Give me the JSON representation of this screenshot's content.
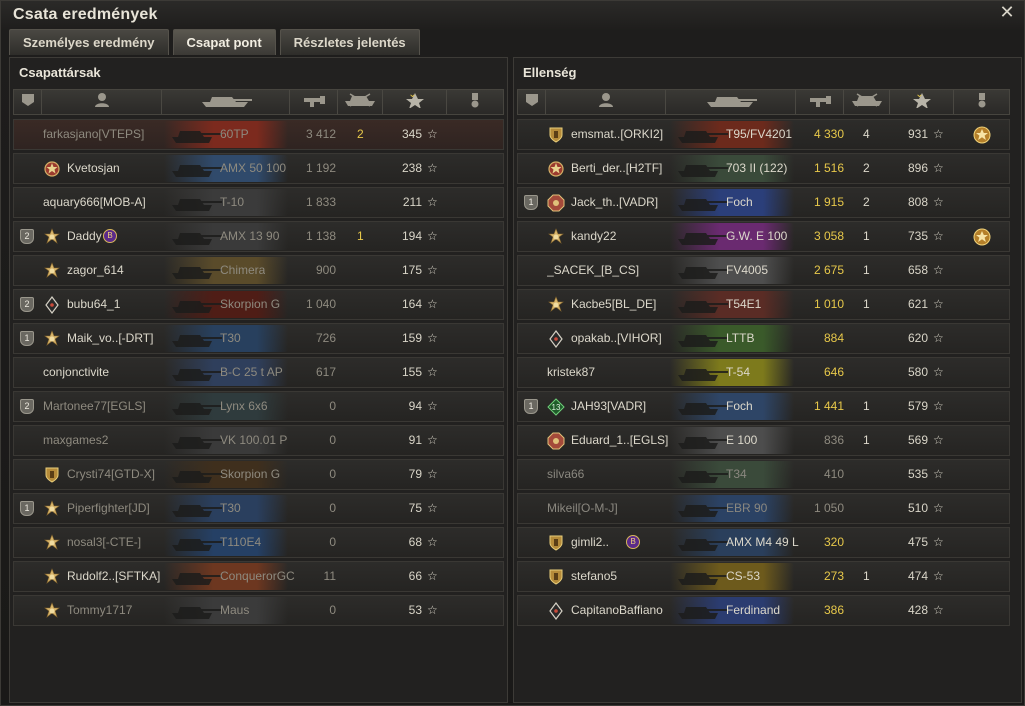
{
  "window": {
    "title": "Csata eredmények",
    "close_glyph": "✕"
  },
  "tabs": [
    {
      "label": "Személyes eredmény",
      "active": false
    },
    {
      "label": "Csapat pont",
      "active": true
    },
    {
      "label": "Részletes jelentés",
      "active": false
    }
  ],
  "left_panel": {
    "title": "Csapattársak",
    "header_icons": [
      "platoon-icon",
      "player-icon",
      "tank-icon",
      "damage-icon",
      "kills-icon",
      "xp-sort-icon",
      "awards-icon"
    ],
    "rows": [
      {
        "name": "farkasjano[VTEPS]",
        "badge": "",
        "medal": "",
        "tank": "60TP",
        "damage": "3 412",
        "kills": "2",
        "xp": "345",
        "dead": true,
        "award": ""
      },
      {
        "name": "Kvetosjan",
        "badge": "",
        "medal": "clan-medal",
        "tank": "AMX 50 100",
        "damage": "1 192",
        "kills": "",
        "xp": "238",
        "dead": false,
        "award": ""
      },
      {
        "name": "aquary666[MOB-A]",
        "badge": "",
        "medal": "",
        "tank": "T-10",
        "damage": "1 833",
        "kills": "",
        "xp": "211",
        "dead": false,
        "award": ""
      },
      {
        "name": "Daddy",
        "badge": "2",
        "medal": "star-medal",
        "tank": "AMX 13 90",
        "damage": "1 138",
        "kills": "1",
        "xp": "194",
        "dead": false,
        "award": "",
        "extra_badge": "B"
      },
      {
        "name": "zagor_614",
        "badge": "",
        "medal": "star-medal",
        "tank": "Chimera",
        "damage": "900",
        "kills": "",
        "xp": "175",
        "dead": false,
        "award": ""
      },
      {
        "name": "bubu64_1",
        "badge": "2",
        "medal": "diamond-medal",
        "tank": "Skorpion G",
        "damage": "1 040",
        "kills": "",
        "xp": "164",
        "dead": false,
        "award": ""
      },
      {
        "name": "Maik_vo..[-DRT]",
        "badge": "1",
        "medal": "star-medal",
        "tank": "T30",
        "damage": "726",
        "kills": "",
        "xp": "159",
        "dead": false,
        "award": ""
      },
      {
        "name": "conjonctivite",
        "badge": "",
        "medal": "",
        "tank": "B-C 25 t AP",
        "damage": "617",
        "kills": "",
        "xp": "155",
        "dead": false,
        "award": ""
      },
      {
        "name": "Martonee77[EGLS]",
        "badge": "2",
        "medal": "",
        "tank": "Lynx 6x6",
        "damage": "0",
        "kills": "",
        "xp": "94",
        "dead": false,
        "award": ""
      },
      {
        "name": "maxgames2",
        "badge": "",
        "medal": "",
        "tank": "VK 100.01 P",
        "damage": "0",
        "kills": "",
        "xp": "91",
        "dead": false,
        "award": ""
      },
      {
        "name": "Crysti74[GTD-X]",
        "badge": "",
        "medal": "shield-medal",
        "tank": "Skorpion G",
        "damage": "0",
        "kills": "",
        "xp": "79",
        "dead": false,
        "award": ""
      },
      {
        "name": "Piperfighter[JD]",
        "badge": "1",
        "medal": "star-medal",
        "tank": "T30",
        "damage": "0",
        "kills": "",
        "xp": "75",
        "dead": false,
        "award": ""
      },
      {
        "name": "nosal3[-CTE-]",
        "badge": "",
        "medal": "star-medal",
        "tank": "T110E4",
        "damage": "0",
        "kills": "",
        "xp": "68",
        "dead": false,
        "award": ""
      },
      {
        "name": "Rudolf2..[SFTKA]",
        "badge": "",
        "medal": "star-medal",
        "tank": "ConquerorGC",
        "damage": "11",
        "kills": "",
        "xp": "66",
        "dead": false,
        "award": ""
      },
      {
        "name": "Tommy1717",
        "badge": "",
        "medal": "star-medal",
        "tank": "Maus",
        "damage": "0",
        "kills": "",
        "xp": "53",
        "dead": false,
        "award": ""
      }
    ]
  },
  "right_panel": {
    "title": "Ellenség",
    "header_icons": [
      "platoon-icon",
      "player-icon",
      "tank-icon",
      "damage-icon",
      "kills-icon",
      "xp-sort-icon",
      "awards-icon"
    ],
    "rows": [
      {
        "name": "emsmat..[ORKI2]",
        "badge": "",
        "medal": "shield-medal",
        "tank": "T95/FV4201",
        "damage": "4 330",
        "kills": "4",
        "xp": "931",
        "dead": false,
        "award": "gold-medal"
      },
      {
        "name": "Berti_der..[H2TF]",
        "badge": "",
        "medal": "clan-medal",
        "tank": "703 II (122)",
        "damage": "1 516",
        "kills": "2",
        "xp": "896",
        "dead": false,
        "award": ""
      },
      {
        "name": "Jack_th..[VADR]",
        "badge": "1",
        "medal": "octagon-medal",
        "tank": "Foch",
        "damage": "1 915",
        "kills": "2",
        "xp": "808",
        "dead": false,
        "award": ""
      },
      {
        "name": "kandy22",
        "badge": "",
        "medal": "star-medal",
        "tank": "G.W. E 100",
        "damage": "3 058",
        "kills": "1",
        "xp": "735",
        "dead": false,
        "award": "gold-medal"
      },
      {
        "name": "_SACEK_[B_CS]",
        "badge": "",
        "medal": "",
        "tank": "FV4005",
        "damage": "2 675",
        "kills": "1",
        "xp": "658",
        "dead": false,
        "award": ""
      },
      {
        "name": "Kacbe5[BL_DE]",
        "badge": "",
        "medal": "star-medal",
        "tank": "T54E1",
        "damage": "1 010",
        "kills": "1",
        "xp": "621",
        "dead": false,
        "award": ""
      },
      {
        "name": "opakab..[VIHOR]",
        "badge": "",
        "medal": "diamond-medal",
        "tank": "LTTB",
        "damage": "884",
        "kills": "",
        "xp": "620",
        "dead": false,
        "award": ""
      },
      {
        "name": "kristek87",
        "badge": "",
        "medal": "",
        "tank": "T-54",
        "damage": "646",
        "kills": "",
        "xp": "580",
        "dead": false,
        "award": ""
      },
      {
        "name": "JAH93[VADR]",
        "badge": "1",
        "medal": "green-medal",
        "tank": "Foch",
        "damage": "1 441",
        "kills": "1",
        "xp": "579",
        "dead": false,
        "award": "",
        "medal_text": "13"
      },
      {
        "name": "Eduard_1..[EGLS]",
        "badge": "",
        "medal": "octagon-medal",
        "tank": "E 100",
        "damage": "836",
        "kills": "1",
        "xp": "569",
        "dead": false,
        "award": ""
      },
      {
        "name": "silva66",
        "badge": "",
        "medal": "",
        "tank": "T34",
        "damage": "410",
        "kills": "",
        "xp": "535",
        "dead": false,
        "award": ""
      },
      {
        "name": "Mikeil[O-M-J]",
        "badge": "",
        "medal": "",
        "tank": "EBR 90",
        "damage": "1 050",
        "kills": "",
        "xp": "510",
        "dead": false,
        "award": ""
      },
      {
        "name": "gimli2..",
        "badge": "",
        "medal": "shield-medal",
        "tank": "AMX M4 49 L",
        "damage": "320",
        "kills": "",
        "xp": "475",
        "dead": false,
        "award": "",
        "extra_badge": "B"
      },
      {
        "name": "stefano5",
        "badge": "",
        "medal": "shield-medal",
        "tank": "CS-53",
        "damage": "273",
        "kills": "1",
        "xp": "474",
        "dead": false,
        "award": ""
      },
      {
        "name": "CapitanoBaffiano",
        "badge": "",
        "medal": "diamond-medal",
        "tank": "Ferdinand",
        "damage": "386",
        "kills": "",
        "xp": "428",
        "dead": false,
        "award": ""
      }
    ]
  },
  "colors": {
    "gold": "#e7c84a",
    "dim": "#8e8a7f",
    "nation_left": [
      "#7c2a1e",
      "#304a6b",
      "#3b3b3b",
      "#3a3a3a",
      "#5a4b2a",
      "#4f1d16",
      "#28405e",
      "#2f3f5c",
      "#2f3b3d",
      "#3a3a3a",
      "#3f2f1d",
      "#2a3f5e",
      "#254065",
      "#6d3720",
      "#3b3b3b"
    ],
    "nation_right": [
      "#6c2a1c",
      "#3a4a3a",
      "#2b3f7a",
      "#6a2a70",
      "#4e4e4e",
      "#5a2c25",
      "#3a5a2a",
      "#7d7a1c",
      "#2e4566",
      "#4d4d4d",
      "#3a4a3a",
      "#2b4264",
      "#2a3f5c",
      "#6d5a1c",
      "#2b3c70"
    ]
  }
}
